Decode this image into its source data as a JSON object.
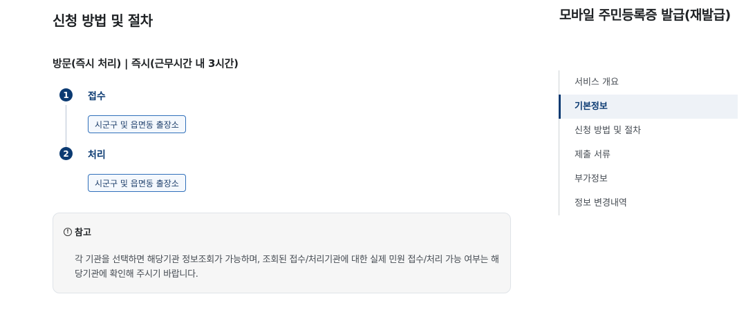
{
  "main": {
    "section_title": "신청 방법 및 절차",
    "method_line": "방문(즉시 처리) | 즉시(근무시간 내 3시간)",
    "steps": [
      {
        "number": "1",
        "label": "접수",
        "place": "시군구 및 읍면동 출장소"
      },
      {
        "number": "2",
        "label": "처리",
        "place": "시군구 및 읍면동 출장소"
      }
    ],
    "note": {
      "icon": "info-icon",
      "title": "참고",
      "body": "각 기관을 선택하면 해당기관 정보조회가 가능하며, 조회된 접수/처리기관에 대한 실제 민원 접수/처리 가능 여부는 해당기관에 확인해 주시기 바랍니다."
    }
  },
  "sidebar": {
    "title": "모바일 주민등록증 발급(재발급)",
    "items": [
      {
        "label": "서비스 개요"
      },
      {
        "label": "기본정보",
        "active": true
      },
      {
        "label": "신청 방법 및 절차"
      },
      {
        "label": "제출 서류"
      },
      {
        "label": "부가정보"
      },
      {
        "label": "정보 변경내역"
      }
    ]
  },
  "colors": {
    "accent": "#0b3a72",
    "chip_border": "#2f6fba",
    "note_bg": "#f6f6f6"
  }
}
